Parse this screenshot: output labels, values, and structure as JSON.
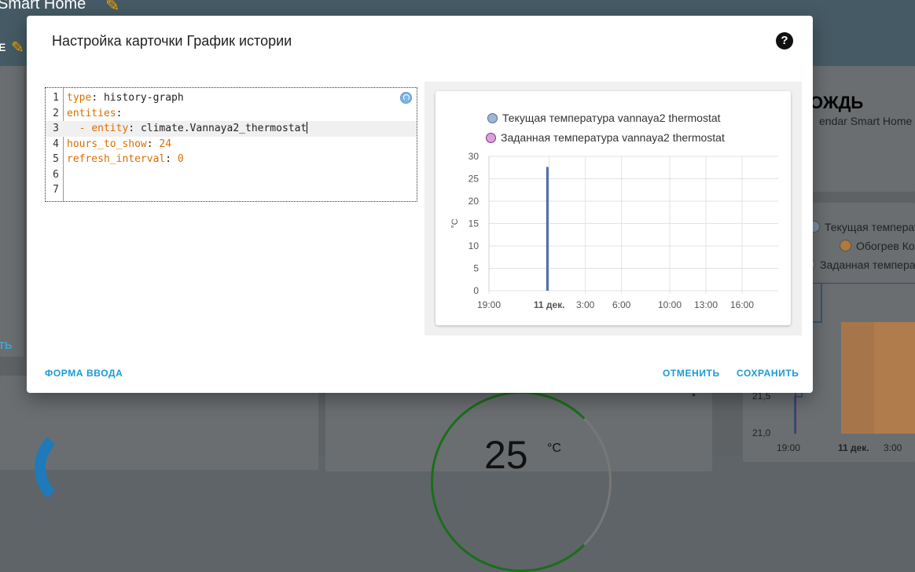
{
  "background": {
    "title": "Smart Home",
    "tab_fragment": "E",
    "link_fragment": "ТЬ",
    "right_card_title": "ОЖДЬ",
    "right_card_subtitle": "endar Smart Home",
    "right_legend": [
      "Текущая температ",
      "Обогрев Ко",
      "Заданная температ"
    ],
    "right_axis_y": [
      "21,5",
      "21,0"
    ],
    "right_axis_x": [
      "19:00",
      "11 дек.",
      "3:00"
    ],
    "gauge_value": "25",
    "gauge_unit": "°C"
  },
  "modal": {
    "title": "Настройка карточки График истории",
    "help_icon": "help-circle-icon",
    "editor": {
      "lines": [
        {
          "num": "1",
          "key": "type",
          "value": "history-graph",
          "value_kind": "text"
        },
        {
          "num": "2",
          "key": "entities",
          "value": "",
          "value_kind": "text"
        },
        {
          "num": "3",
          "key": "entity",
          "value": "climate.Vannaya2_thermostat",
          "value_kind": "text",
          "list_item": true
        },
        {
          "num": "4",
          "key": "hours_to_show",
          "value": "24",
          "value_kind": "number"
        },
        {
          "num": "5",
          "key": "refresh_interval",
          "value": "0",
          "value_kind": "number"
        },
        {
          "num": "6",
          "key": "",
          "value": ""
        },
        {
          "num": "7",
          "key": "",
          "value": ""
        }
      ]
    },
    "footer": {
      "form_mode": "ФОРМА ВВОДА",
      "cancel": "ОТМЕНИТЬ",
      "save": "СОХРАНИТЬ"
    }
  },
  "colors": {
    "accent": "#1c9ad6",
    "series_current": "#4a6fa5",
    "series_current_fill": "#9fb6cf",
    "series_target_fill": "#d7a3d7",
    "series_target_border": "#8b2e8b"
  },
  "chart_data": {
    "type": "line",
    "legend": [
      "Текущая температура vannaya2 thermostat",
      "Заданная температура vannaya2 thermostat"
    ],
    "ylabel": "°C",
    "ylim": [
      0,
      30
    ],
    "y_ticks": [
      0,
      5,
      10,
      15,
      20,
      25,
      30
    ],
    "x_ticks": [
      "19:00",
      "11 дек.",
      "3:00",
      "6:00",
      "10:00",
      "13:00",
      "16:00"
    ],
    "x_tick_hours": [
      19,
      24,
      27,
      30,
      34,
      37,
      40
    ],
    "xlim_hours": [
      19,
      43
    ],
    "grid": true,
    "series": [
      {
        "name": "Текущая температура vannaya2 thermostat",
        "points": [
          {
            "x_hours": 23.8,
            "y": 0
          },
          {
            "x_hours": 23.8,
            "y": 27.5
          },
          {
            "x_hours": 23.9,
            "y": 27.5
          },
          {
            "x_hours": 23.9,
            "y": 0
          }
        ]
      }
    ]
  }
}
